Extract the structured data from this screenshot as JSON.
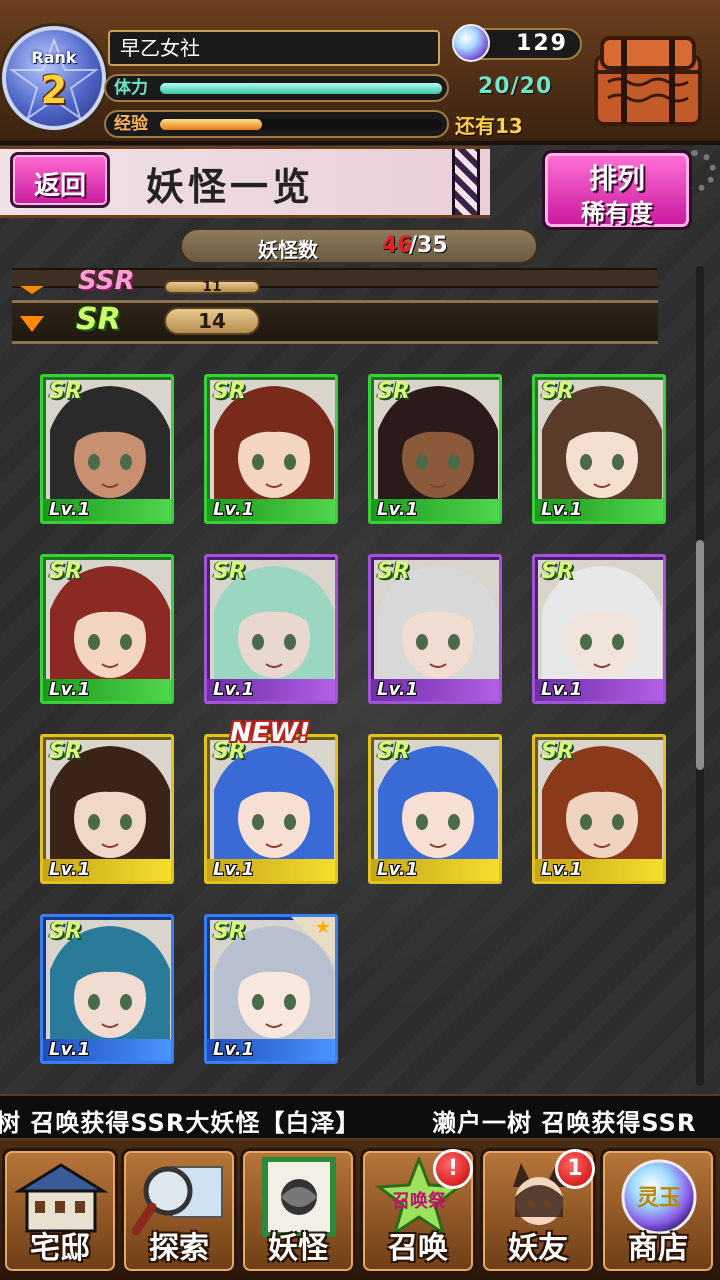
{
  "hud": {
    "rank_label": "Rank",
    "rank_value": "2",
    "player_name": "早乙女社",
    "hp_label": "体力",
    "hp_value": "20/20",
    "hp_fraction": 1.0,
    "exp_label": "经验",
    "exp_remaining": "还有13",
    "exp_fraction": 0.36,
    "gem_count": "129"
  },
  "header": {
    "back_label": "返回",
    "title": "妖怪一览",
    "sort_label": "排列",
    "sort_value": "稀有度"
  },
  "count": {
    "label": "妖怪数",
    "current": "46",
    "max": "/35"
  },
  "rarity_groups": [
    {
      "rarity": "SSR",
      "count": "11"
    },
    {
      "rarity": "SR",
      "count": "14"
    }
  ],
  "cards": [
    {
      "rarity": "SR",
      "level": "Lv.1",
      "frame": "green",
      "new": false
    },
    {
      "rarity": "SR",
      "level": "Lv.1",
      "frame": "green",
      "new": false
    },
    {
      "rarity": "SR",
      "level": "Lv.1",
      "frame": "green",
      "new": false
    },
    {
      "rarity": "SR",
      "level": "Lv.1",
      "frame": "green",
      "new": false
    },
    {
      "rarity": "SR",
      "level": "Lv.1",
      "frame": "green",
      "new": false
    },
    {
      "rarity": "SR",
      "level": "Lv.1",
      "frame": "purple",
      "new": false
    },
    {
      "rarity": "SR",
      "level": "Lv.1",
      "frame": "purple",
      "new": false
    },
    {
      "rarity": "SR",
      "level": "Lv.1",
      "frame": "purple",
      "new": false
    },
    {
      "rarity": "SR",
      "level": "Lv.1",
      "frame": "gold",
      "new": false
    },
    {
      "rarity": "SR",
      "level": "Lv.1",
      "frame": "gold",
      "new": true
    },
    {
      "rarity": "SR",
      "level": "Lv.1",
      "frame": "gold",
      "new": false
    },
    {
      "rarity": "SR",
      "level": "Lv.1",
      "frame": "gold",
      "new": false
    },
    {
      "rarity": "SR",
      "level": "Lv.1",
      "frame": "blue",
      "new": false
    },
    {
      "rarity": "SR",
      "level": "Lv.1",
      "frame": "blue",
      "new": false,
      "star": true
    }
  ],
  "new_label": "NEW!",
  "ticker": {
    "msg1": "树 召唤获得SSR大妖怪【白泽】",
    "msg2": "濑户一树 召唤获得SSR"
  },
  "nav": [
    {
      "label": "宅邸",
      "icon": "mansion-icon",
      "badge": null
    },
    {
      "label": "探索",
      "icon": "magnifier-map-icon",
      "badge": null
    },
    {
      "label": "妖怪",
      "icon": "scroll-icon",
      "badge": null
    },
    {
      "label": "召唤",
      "icon": "summon-star-icon",
      "badge": "!",
      "sub_label": "召唤祭"
    },
    {
      "label": "妖友",
      "icon": "fox-girl-icon",
      "badge": "1"
    },
    {
      "label": "商店",
      "icon": "crystal-orb-icon",
      "badge": null,
      "sub_label": "灵玉"
    }
  ],
  "colors": {
    "frame_green": "#3bd03b",
    "frame_purple": "#a154d6",
    "frame_gold": "#e1c221",
    "frame_blue": "#3a7ef2",
    "accent_pink": "#e23bb9"
  }
}
